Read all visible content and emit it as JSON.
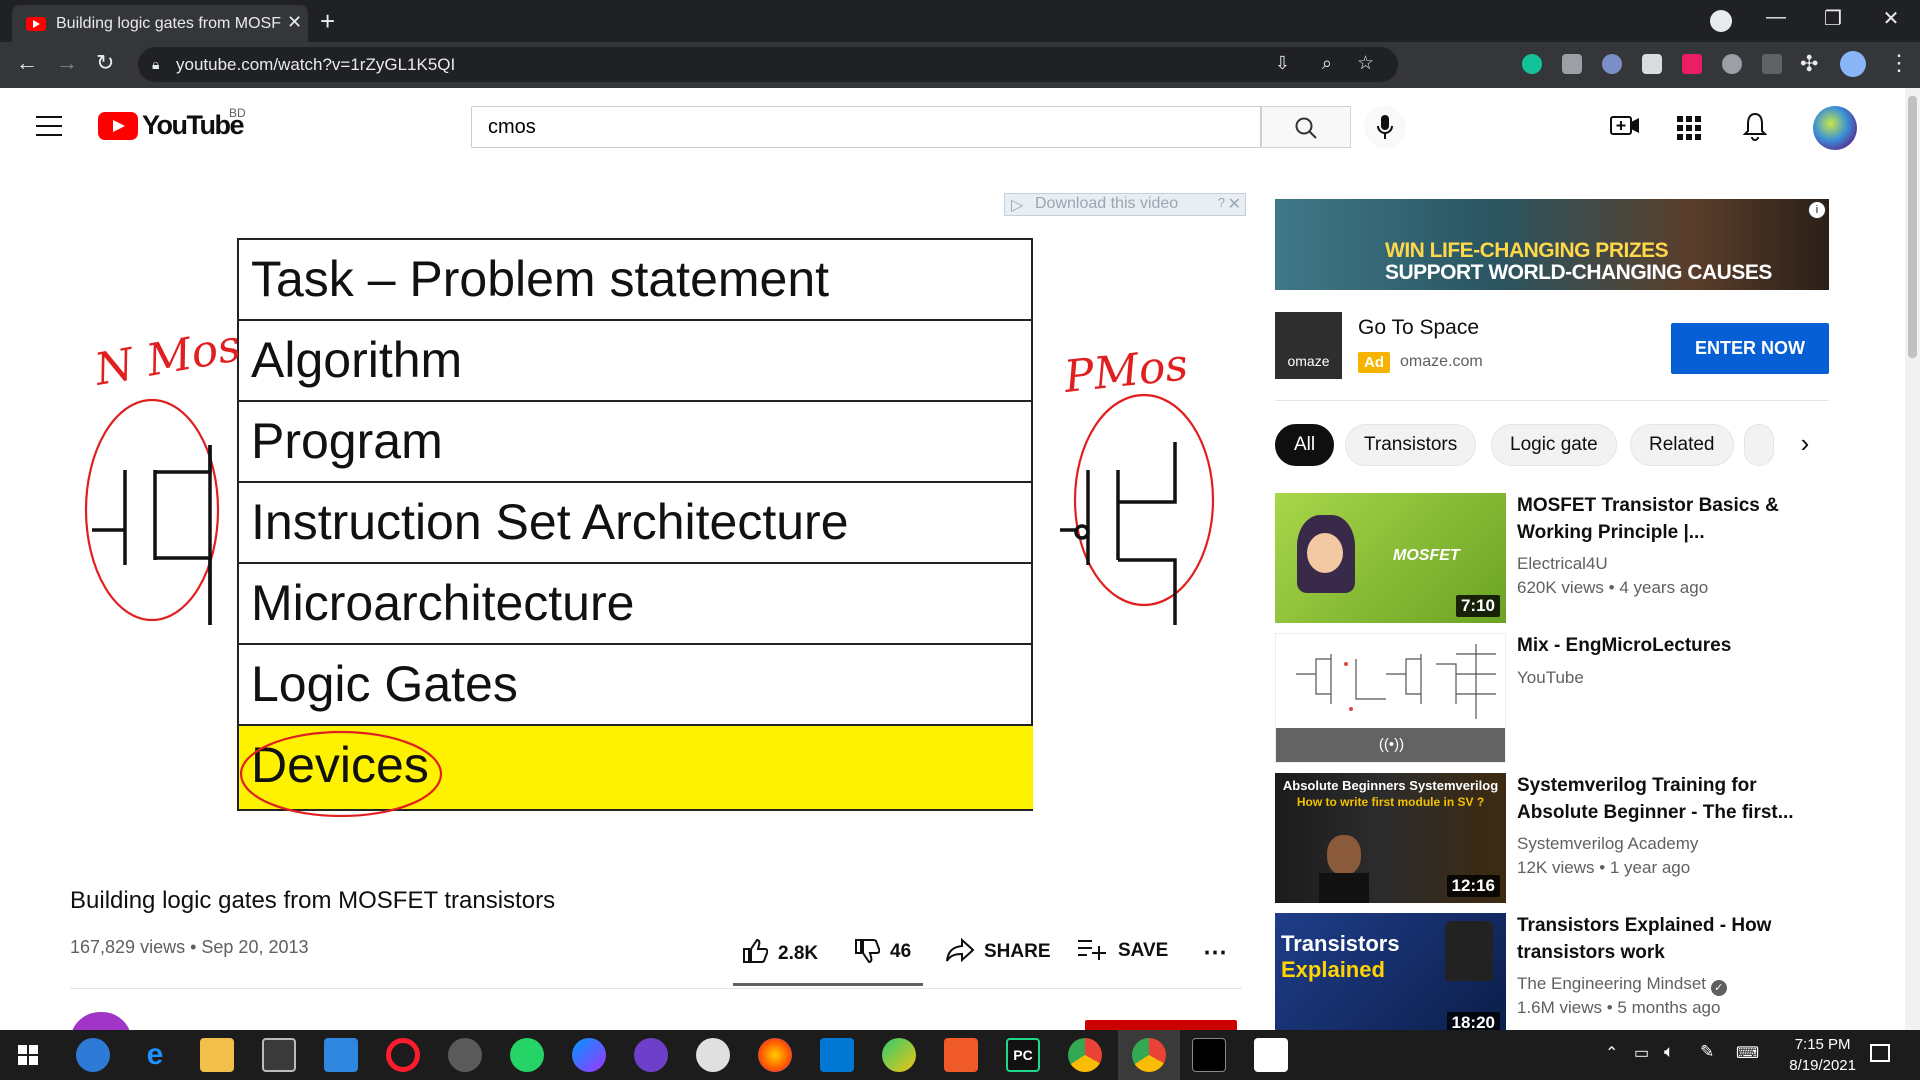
{
  "browser": {
    "tab_title": "Building logic gates from MOSFE",
    "url": "youtube.com/watch?v=1rZyGL1K5QI"
  },
  "header": {
    "logo_text": "YouTube",
    "region": "BD",
    "search_value": "cmos"
  },
  "video": {
    "download_banner": "Download this video",
    "rows": [
      "Task – Problem statement",
      "Algorithm",
      "Program",
      "Instruction Set Architecture",
      "Microarchitecture",
      "Logic Gates",
      "Devices"
    ],
    "highlight_color": "#fff200",
    "annotation_color": "#e02020",
    "left_note": "N Mos",
    "right_note": "PMos",
    "title": "Building logic gates from MOSFET transistors",
    "views": "167,829 views",
    "date": "Sep 20, 2013",
    "likes": "2.8K",
    "dislikes": "46",
    "share_label": "SHARE",
    "save_label": "SAVE"
  },
  "ad": {
    "banner_line1": "WIN LIFE-CHANGING PRIZES",
    "banner_line2": "SUPPORT WORLD-CHANGING CAUSES",
    "logo_text": "omaze",
    "title": "Go To Space",
    "badge": "Ad",
    "domain": "omaze.com",
    "cta": "ENTER NOW"
  },
  "chips": [
    "All",
    "Transistors",
    "Logic gate",
    "Related"
  ],
  "related": [
    {
      "title": "MOSFET Transistor Basics & Working Principle |...",
      "channel": "Electrical4U",
      "meta": "620K views • 4 years ago",
      "duration": "7:10",
      "thumb_text": "MOSFET"
    },
    {
      "title": "Mix - EngMicroLectures",
      "channel": "YouTube",
      "meta": "",
      "duration": "",
      "thumb_text": "((•))"
    },
    {
      "title": "Systemverilog Training for Absolute Beginner - The first...",
      "channel": "Systemverilog Academy",
      "meta": "12K views • 1 year ago",
      "duration": "12:16",
      "thumb_text": "Absolute Beginners Systemverilog",
      "thumb_sub": "How to write first module in SV ?"
    },
    {
      "title": "Transistors Explained - How transistors work",
      "channel": "The Engineering Mindset",
      "meta": "1.6M views • 5 months ago",
      "duration": "18:20",
      "thumb_text": "Transistors",
      "thumb_sub": "Explained"
    }
  ],
  "taskbar": {
    "time": "7:15 PM",
    "date": "8/19/2021"
  }
}
